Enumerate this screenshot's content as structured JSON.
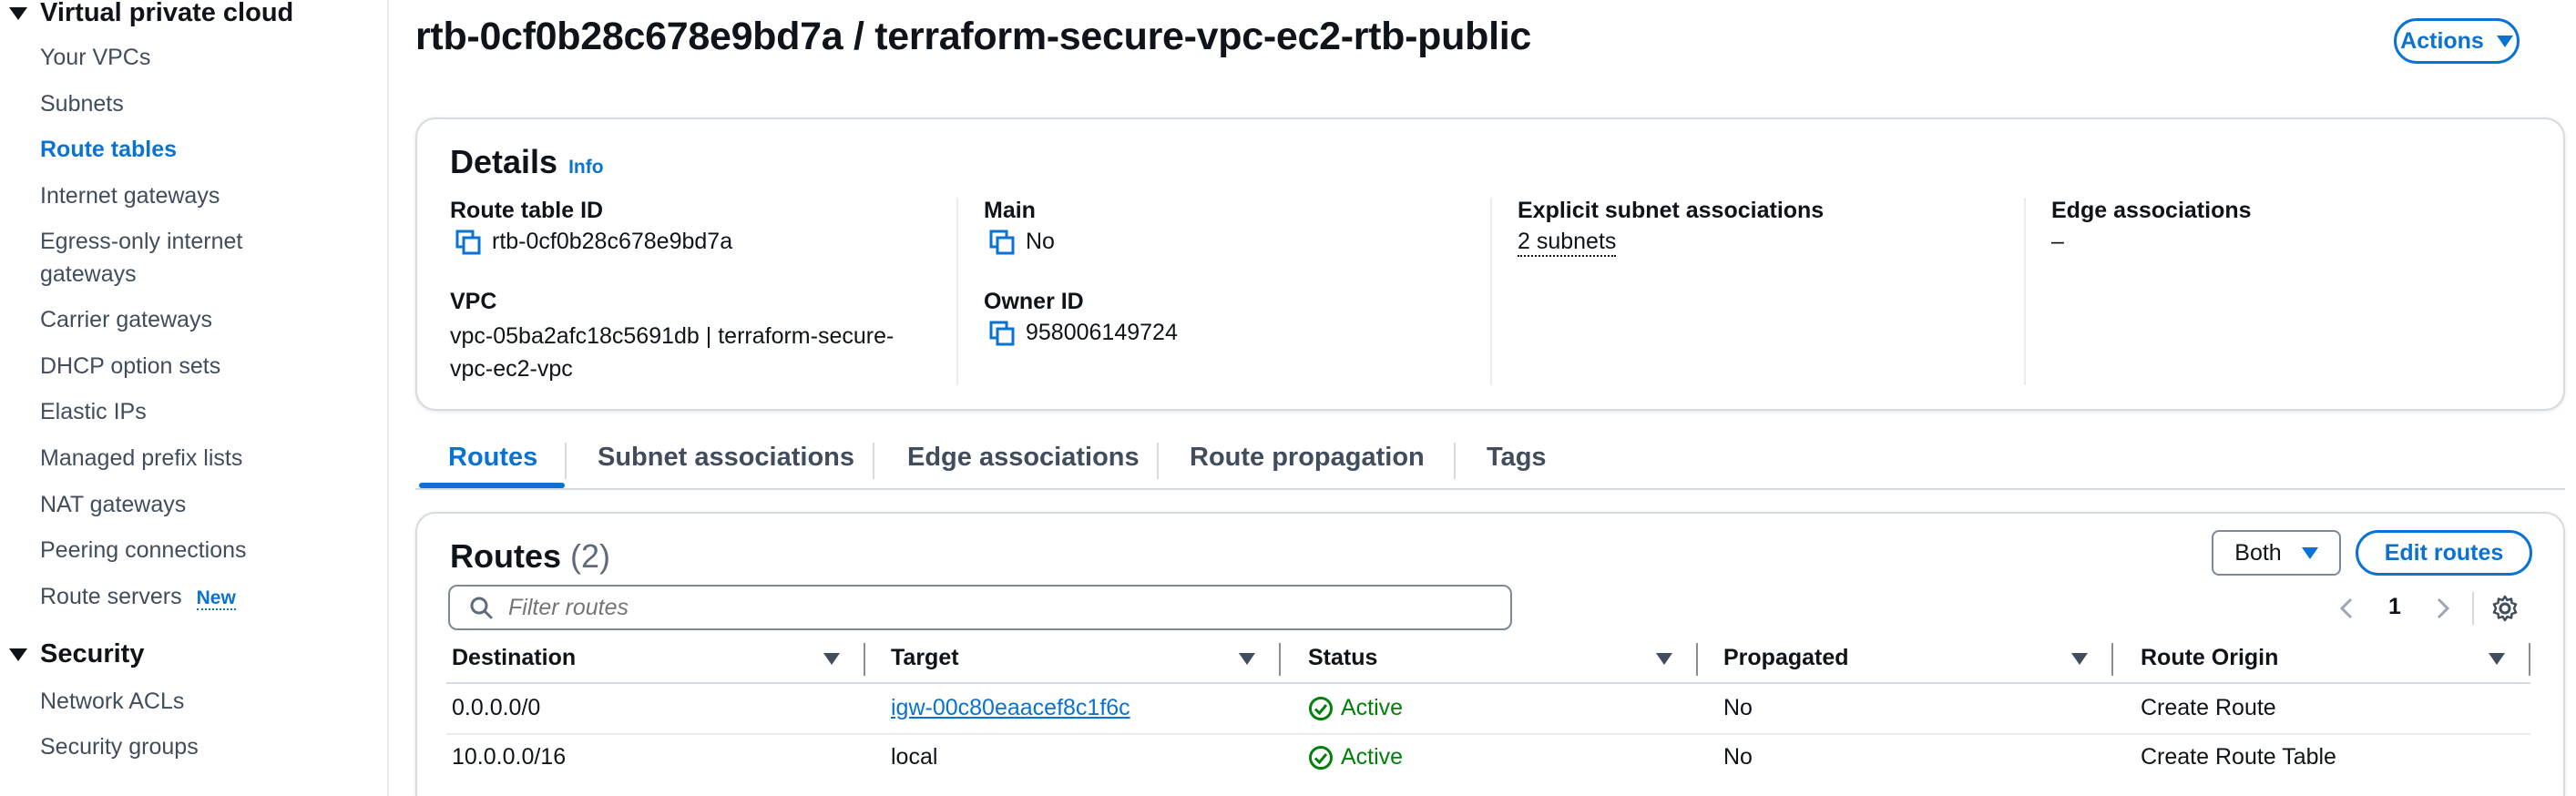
{
  "sidebar": {
    "section_vpc": "Virtual private cloud",
    "items": [
      {
        "label": "Your VPCs"
      },
      {
        "label": "Subnets"
      },
      {
        "label": "Route tables"
      },
      {
        "label": "Internet gateways"
      },
      {
        "label": "Egress-only internet gateways"
      },
      {
        "label": "Carrier gateways"
      },
      {
        "label": "DHCP option sets"
      },
      {
        "label": "Elastic IPs"
      },
      {
        "label": "Managed prefix lists"
      },
      {
        "label": "NAT gateways"
      },
      {
        "label": "Peering connections"
      },
      {
        "label": "Route servers"
      }
    ],
    "new_badge": "New",
    "section_security": "Security",
    "security_items": [
      {
        "label": "Network ACLs"
      },
      {
        "label": "Security groups"
      }
    ]
  },
  "header": {
    "title": "rtb-0cf0b28c678e9bd7a / terraform-secure-vpc-ec2-rtb-public",
    "actions_label": "Actions"
  },
  "details": {
    "title": "Details",
    "info": "Info",
    "route_table_id_label": "Route table ID",
    "route_table_id": "rtb-0cf0b28c678e9bd7a",
    "vpc_label": "VPC",
    "vpc_value": "vpc-05ba2afc18c5691db | terraform-secure-vpc-ec2-vpc",
    "main_label": "Main",
    "main_value": "No",
    "owner_label": "Owner ID",
    "owner_value": "958006149724",
    "explicit_label": "Explicit subnet associations",
    "explicit_value": "2 subnets",
    "edge_label": "Edge associations",
    "edge_value": "–"
  },
  "tabs": [
    {
      "label": "Routes",
      "active": true
    },
    {
      "label": "Subnet associations"
    },
    {
      "label": "Edge associations"
    },
    {
      "label": "Route propagation"
    },
    {
      "label": "Tags"
    }
  ],
  "routes": {
    "title": "Routes",
    "count": "(2)",
    "both_label": "Both",
    "edit_label": "Edit routes",
    "filter_placeholder": "Filter routes",
    "page": "1",
    "columns": [
      "Destination",
      "Target",
      "Status",
      "Propagated",
      "Route Origin"
    ],
    "rows": [
      {
        "destination": "0.0.0.0/0",
        "target": "igw-00c80eaacef8c1f6c",
        "target_link": true,
        "status": "Active",
        "propagated": "No",
        "origin": "Create Route"
      },
      {
        "destination": "10.0.0.0/16",
        "target": "local",
        "target_link": false,
        "status": "Active",
        "propagated": "No",
        "origin": "Create Route Table"
      }
    ]
  },
  "colors": {
    "accent": "#0972d3",
    "success": "#037f0c",
    "text": "#0f141a"
  }
}
